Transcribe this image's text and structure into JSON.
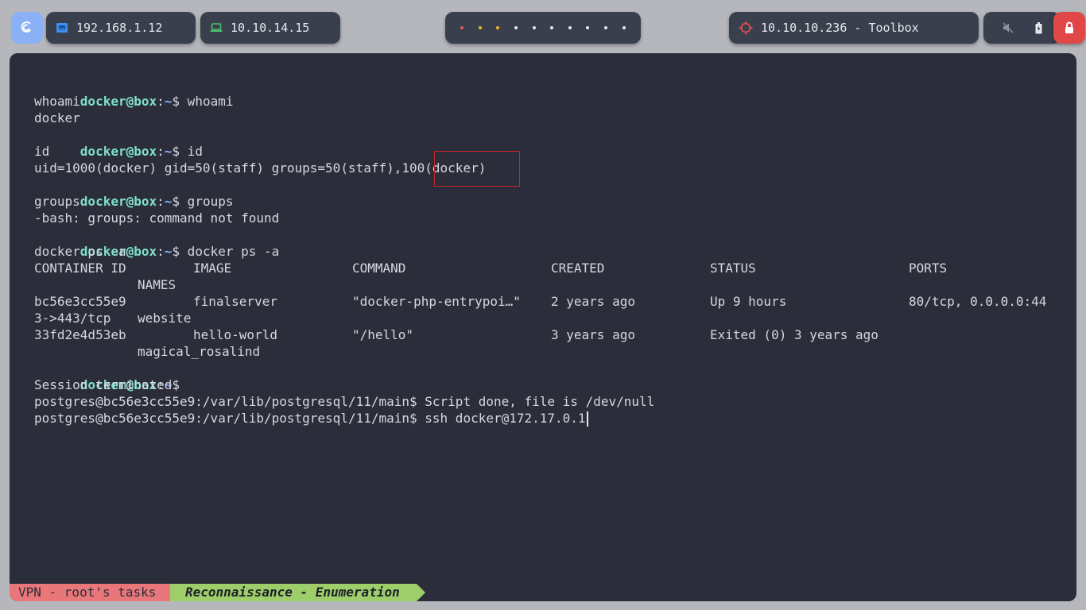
{
  "topbar": {
    "local_ip": "192.168.1.12",
    "vpn_ip": "10.10.14.15",
    "target": "10.10.10.236 - Toolbox",
    "workspaces": [
      {
        "color": "#e05a5a"
      },
      {
        "color": "#f0b429"
      },
      {
        "color": "#f0b429"
      },
      {
        "color": "#e8e8ee"
      },
      {
        "color": "#e8e8ee"
      },
      {
        "color": "#e8e8ee"
      },
      {
        "color": "#e8e8ee"
      },
      {
        "color": "#e8e8ee"
      },
      {
        "color": "#e8e8ee"
      },
      {
        "color": "#e8e8ee"
      }
    ],
    "icons": {
      "logo": "debian-swirl-icon",
      "local": "ethernet-icon",
      "vpn": "laptop-icon",
      "target": "crosshair-icon",
      "volume": "volume-muted-icon",
      "battery": "battery-icon",
      "power": "power-icon"
    }
  },
  "terminal": {
    "prompt": {
      "user": "docker@box",
      "sep": ":",
      "path": "~",
      "symbol": "$"
    },
    "lines": {
      "l1_cmd": " whoami",
      "l2": "whoami",
      "l3": "docker",
      "l4_cmd": " id",
      "l5": "id",
      "l6": "uid=1000(docker) gid=50(staff) groups=50(staff),100(docker)",
      "l7_cmd": " groups",
      "l8": "groups",
      "l9": "-bash: groups: command not found",
      "l10_cmd": " docker ps -a",
      "l11": "docker ps -a",
      "l20": "Session terminated.",
      "l21": "postgres@bc56e3cc55e9:/var/lib/postgresql/11/main$ Script done, file is /dev/null",
      "l22": "postgres@bc56e3cc55e9:/var/lib/postgresql/11/main$ ssh docker@172.17.0.1"
    },
    "docker_table": {
      "headers": [
        "CONTAINER ID",
        "IMAGE",
        "COMMAND",
        "CREATED",
        "STATUS",
        "PORTS",
        "NAMES"
      ],
      "rows": [
        {
          "id": "bc56e3cc55e9",
          "image": "finalserver",
          "command": "\"docker-php-entrypoi…\"",
          "created": "2 years ago",
          "status": "Up 9 hours",
          "ports_1": "80/tcp, 0.0.0.0:44",
          "ports_2": "3->443/tcp",
          "names": "website"
        },
        {
          "id": "33fd2e4d53eb",
          "image": "hello-world",
          "command": "\"/hello\"",
          "created": "3 years ago",
          "status": "Exited (0) 3 years ago",
          "ports_1": "",
          "ports_2": "",
          "names": "magical_rosalind"
        }
      ]
    },
    "highlight_color": "#c62828"
  },
  "statusbar": {
    "session": "VPN - root's tasks",
    "window": "Reconnaissance - Enumeration",
    "colors": {
      "session_bg": "#e9777a",
      "window_bg": "#9ece6a"
    }
  }
}
